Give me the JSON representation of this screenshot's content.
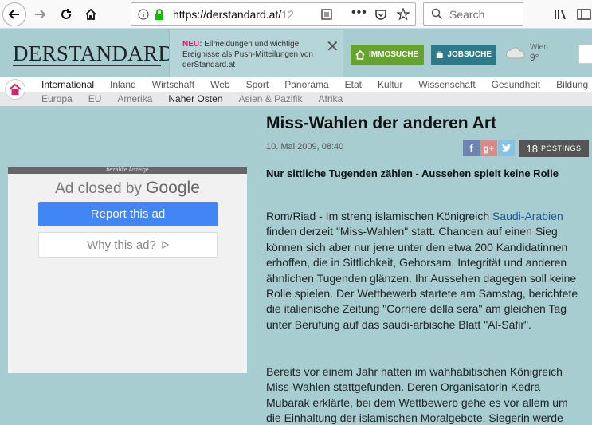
{
  "browser": {
    "url_host": "https://derstandard.at/",
    "url_rest": "12",
    "search_placeholder": "Search"
  },
  "header": {
    "logo": "DERSTANDARD",
    "notice_new": "NEU:",
    "notice_text": " Eilmeldungen und wichtige Ereignisse als Push-Mitteilungen von derStandard.at",
    "immosuche": "IMMOSUCHE",
    "jobsuche": "JOBSUCHE",
    "weather_city": "Wien",
    "weather_temp": "9°"
  },
  "nav": {
    "items": [
      "International",
      "Inland",
      "Wirtschaft",
      "Web",
      "Sport",
      "Panorama",
      "Etat",
      "Kultur",
      "Wissenschaft",
      "Gesundheit",
      "Bildung"
    ],
    "subitems": [
      "Europa",
      "EU",
      "Amerika",
      "Naher Osten",
      "Asien & Pazifik",
      "Afrika"
    ]
  },
  "ad": {
    "label": "bezahlte Anzeige",
    "closed_prefix": "Ad closed by ",
    "closed_brand": "Google",
    "report": "Report this ad",
    "why": "Why this ad?"
  },
  "article": {
    "headline": "Miss-Wahlen der anderen Art",
    "date": "10. Mai 2009, 08:40",
    "postings_count": "18",
    "postings_label": "POSTINGS",
    "lead": "Nur sittliche Tugenden zählen - Aussehen spielt keine Rolle",
    "p1_start": "Rom/Riad - Im streng islamischen Königreich ",
    "p1_link": "Saudi-Arabien",
    "p1_rest": " finden derzeit \"Miss-Wahlen\" statt. Chancen auf einen Sieg können sich aber nur jene unter den etwa 200 Kandidatinnen erhoffen, die in Sittlichkeit, Gehorsam, Integrität und anderen ähnlichen Tugenden glänzen. Ihr Aussehen dagegen soll keine Rolle spielen. Der Wettbewerb startete am Samstag, berichtete die italienische Zeitung \"Corriere della sera\" am gleichen Tag unter Berufung auf das saudi-arbische Blatt \"Al-Safir\".",
    "p2": "Bereits vor einem Jahr hatten im wahhabitischen Königreich Miss-Wahlen stattgefunden. Deren Organisatorin Kedra Mubarak erklärte, bei dem Wettbewerb gehe es vor allem um die Einhaltung der islamischen Moralgebote. Siegerin werde"
  }
}
